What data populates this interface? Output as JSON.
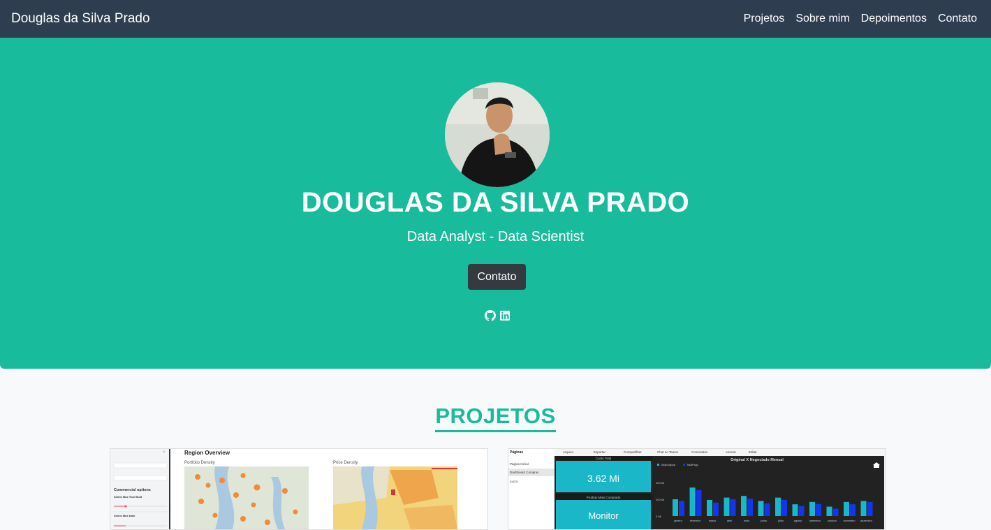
{
  "navbar": {
    "brand": "Douglas da Silva Prado",
    "links": [
      "Projetos",
      "Sobre mim",
      "Depoimentos",
      "Contato"
    ]
  },
  "hero": {
    "title": "DOUGLAS DA SILVA PRADO",
    "subtitle": "Data Analyst - Data Scientist",
    "button": "Contato",
    "icons": [
      "github-icon",
      "linkedin-icon"
    ]
  },
  "projects": {
    "title": "PROJETOS",
    "card1": {
      "header": "Region Overview",
      "map1": "Portfolio Density",
      "map2": "Price Density",
      "sidebar_heading": "Commercial options",
      "sidebar_opt1": "Select Max Year Built",
      "sidebar_opt2": "Select Max Date"
    },
    "card2": {
      "toolbar": [
        "Arquivo",
        "Exportar",
        "Compartilhar",
        "Chat no Teams",
        "Comentário",
        "Assinar",
        "Editar"
      ],
      "pages_title": "Páginas",
      "pages": [
        "Página Inicial",
        "Dashboard Compras",
        "Lucro"
      ],
      "kpi1_label": "Custo Total",
      "kpi1_value": "3.62 Mi",
      "kpi2_label": "Produto Mais Comprado",
      "kpi2_value": "Monitor",
      "chart_title": "Original X Negociado Mensal",
      "legend": [
        "TotalOriginal",
        "TotalPago"
      ],
      "y_ticks": [
        "400 Mi",
        "200 Mi",
        "0 Mi"
      ],
      "months": [
        "janeiro",
        "fevereiro",
        "março",
        "abril",
        "maio",
        "junho",
        "julho",
        "agosto",
        "setembro",
        "outubro",
        "novembro",
        "dezembro"
      ]
    }
  },
  "colors": {
    "nav": "#2e3e50",
    "accent": "#18bc9c",
    "button": "#343a40"
  }
}
